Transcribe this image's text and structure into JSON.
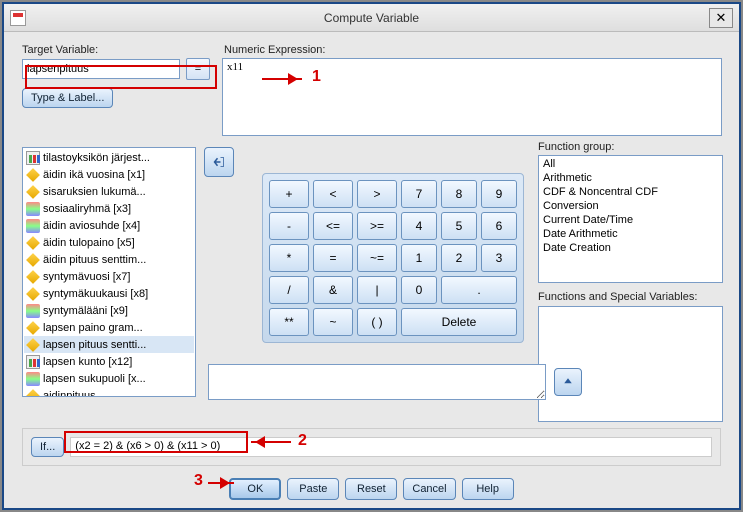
{
  "window": {
    "title": "Compute Variable"
  },
  "target": {
    "label": "Target Variable:",
    "value": "lapsenpituus",
    "equals": "=",
    "typeLabel": "Type & Label..."
  },
  "numexp": {
    "label": "Numeric Expression:",
    "value": "x11"
  },
  "variables": [
    {
      "icon": "ordinal",
      "label": "tilastoyksikön järjest..."
    },
    {
      "icon": "scale",
      "label": "äidin ikä vuosina [x1]"
    },
    {
      "icon": "scale",
      "label": "sisaruksien lukumä..."
    },
    {
      "icon": "nominal",
      "label": "sosiaaliryhmä [x3]"
    },
    {
      "icon": "nominal",
      "label": "äidin aviosuhde [x4]"
    },
    {
      "icon": "scale",
      "label": "äidin tulopaino [x5]"
    },
    {
      "icon": "scale",
      "label": "äidin pituus senttim..."
    },
    {
      "icon": "scale",
      "label": "syntymävuosi [x7]"
    },
    {
      "icon": "scale",
      "label": "syntymäkuukausi [x8]"
    },
    {
      "icon": "nominal",
      "label": "syntymälääni [x9]"
    },
    {
      "icon": "scale",
      "label": "lapsen paino gram..."
    },
    {
      "icon": "scale",
      "label": "lapsen pituus sentti...",
      "selected": true
    },
    {
      "icon": "ordinal",
      "label": "lapsen kunto [x12]"
    },
    {
      "icon": "nominal",
      "label": "lapsen sukupuoli [x..."
    },
    {
      "icon": "scale",
      "label": "aidinpituus"
    }
  ],
  "keypad": {
    "rows": [
      [
        "+",
        "<",
        ">",
        "7",
        "8",
        "9"
      ],
      [
        "-",
        "<=",
        ">=",
        "4",
        "5",
        "6"
      ],
      [
        "*",
        "=",
        "~=",
        "1",
        "2",
        "3"
      ],
      [
        "/",
        "&",
        "|",
        "0",
        "."
      ],
      [
        "**",
        "~",
        "( )",
        "Delete"
      ]
    ]
  },
  "funcGroup": {
    "label": "Function group:",
    "items": [
      "All",
      "Arithmetic",
      "CDF & Noncentral CDF",
      "Conversion",
      "Current Date/Time",
      "Date Arithmetic",
      "Date Creation"
    ]
  },
  "funcVar": {
    "label": "Functions and Special Variables:"
  },
  "ifSection": {
    "btn": "If...",
    "condition": "(x2 = 2) & (x6 > 0) & (x11 > 0)"
  },
  "buttons": {
    "ok": "OK",
    "paste": "Paste",
    "reset": "Reset",
    "cancel": "Cancel",
    "help": "Help"
  },
  "annotations": {
    "n1": "1",
    "n2": "2",
    "n3": "3"
  }
}
